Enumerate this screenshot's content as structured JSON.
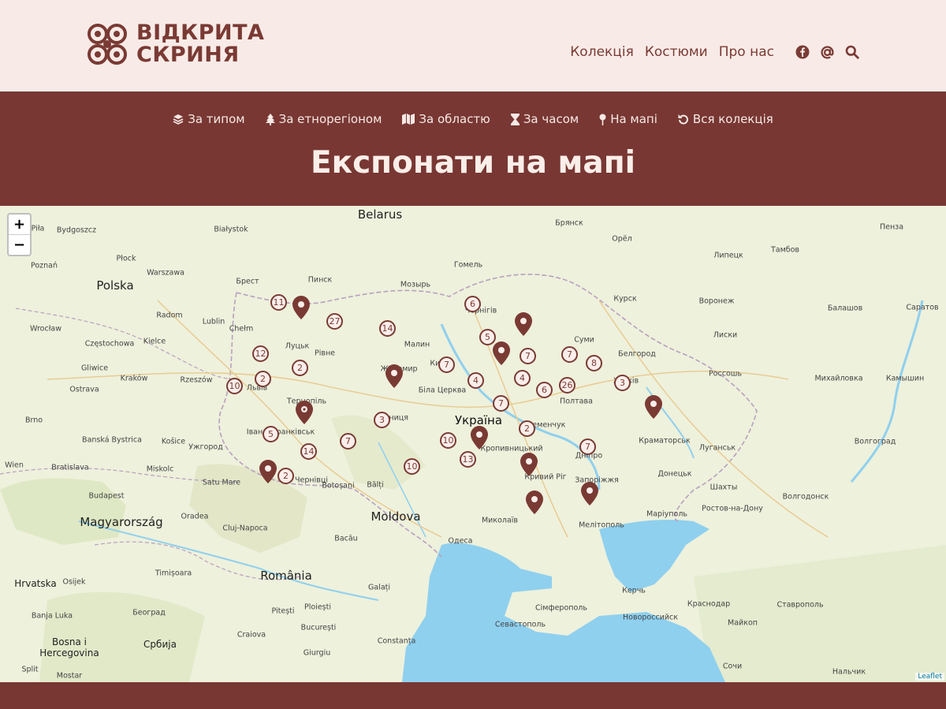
{
  "brand": {
    "line1": "ВІДКРИТА",
    "line2": "СКРИНЯ",
    "color": "#7a3a34"
  },
  "topnav": {
    "links": [
      "Колекція",
      "Костюми",
      "Про нас"
    ],
    "icons": [
      "facebook-icon",
      "at-icon",
      "search-icon"
    ]
  },
  "catnav": {
    "items": [
      {
        "label": "За типом",
        "icon": "layers-icon"
      },
      {
        "label": "За етнорегіоном",
        "icon": "tree-icon"
      },
      {
        "label": "За областю",
        "icon": "map-icon"
      },
      {
        "label": "За часом",
        "icon": "hourglass-icon"
      },
      {
        "label": "На мапі",
        "icon": "map-pin-icon"
      },
      {
        "label": "Вся колекція",
        "icon": "undo-icon"
      }
    ]
  },
  "page_title": "Експонати на мапі",
  "map": {
    "zoom_in": "+",
    "zoom_out": "−",
    "attribution": "Leaflet",
    "colors": {
      "land": "#eef1dc",
      "sea": "#8fd0ef",
      "accent": "#783733",
      "cluster_fill": "#fbeeea"
    },
    "labels": {
      "countries": [
        "Belarus",
        "Polska",
        "Україна",
        "Moldova",
        "Magyarország",
        "România",
        "Hrvatska",
        "Bosna i Hercegovina",
        "Србија"
      ],
      "cities": [
        "Брянск",
        "Орёл",
        "Пенза",
        "Тамбов",
        "Липецк",
        "Курск",
        "Воронеж",
        "Саратов",
        "Балашов",
        "Белгород",
        "Лиски",
        "Россошь",
        "Михайловка",
        "Камышин",
        "Волгоград",
        "Краматорськ",
        "Луганськ",
        "Донецьк",
        "Шахты",
        "Волгодонск",
        "Ростов-на-Дону",
        "Маріуполь",
        "Мелітополь",
        "Запоріжжя",
        "Кривий Ріг",
        "Кропивницький",
        "Полтава",
        "Суми",
        "Миколаїв",
        "Одеса",
        "Сімферополь",
        "Севастополь",
        "Керчь",
        "Новороссийск",
        "Краснодар",
        "Ставрополь",
        "Майкоп",
        "Сочи",
        "Нальчик",
        "Гомель",
        "Мозырь",
        "Пинск",
        "Брест",
        "Białystok",
        "Warszawa",
        "Radom",
        "Lublin",
        "Chełm",
        "Kielce",
        "Częstochowa",
        "Kraków",
        "Rzeszów",
        "Gliwice",
        "Ostrava",
        "Brno",
        "Wien",
        "Bratislava",
        "Banská Bystrica",
        "Košice",
        "Miskolc",
        "Budapest",
        "Ужгород",
        "Satu Mare",
        "Oradea",
        "Cluj-Napoca",
        "Bacău",
        "Botoșani",
        "Bălți",
        "Galați",
        "Timișoara",
        "București",
        "Craiova",
        "Pitești",
        "Ploiești",
        "Constanța",
        "Giurgiu",
        "Београд",
        "Osijek",
        "Banja Luka",
        "Split",
        "Mostar",
        "Bydgoszcz",
        "Piła",
        "Poznań",
        "Płock",
        "Wrocław",
        "Луцьк",
        "Рівне",
        "Львів",
        "Тернопіль",
        "Івано-Франківськ",
        "Житомир",
        "Малин",
        "Біла Церква",
        "Вінниця",
        "Чернівці",
        "Київ",
        "Чернігів",
        "Дніпро",
        "Харків",
        "Кременчук"
      ]
    },
    "clusters": [
      11,
      27,
      14,
      6,
      5,
      7,
      7,
      8,
      12,
      2,
      10,
      2,
      7,
      4,
      4,
      6,
      26,
      3,
      7,
      3,
      2,
      5,
      14,
      7,
      10,
      13,
      7,
      2,
      10
    ],
    "markers": [
      "Ковель",
      "Суми-захід",
      "Київ",
      "Житомир",
      "Тернопіль",
      "Луганськ",
      "Кропивницький",
      "Кривий Ріг",
      "Мукачево-Карпати",
      "Нікополь",
      "Запоріжжя"
    ]
  }
}
